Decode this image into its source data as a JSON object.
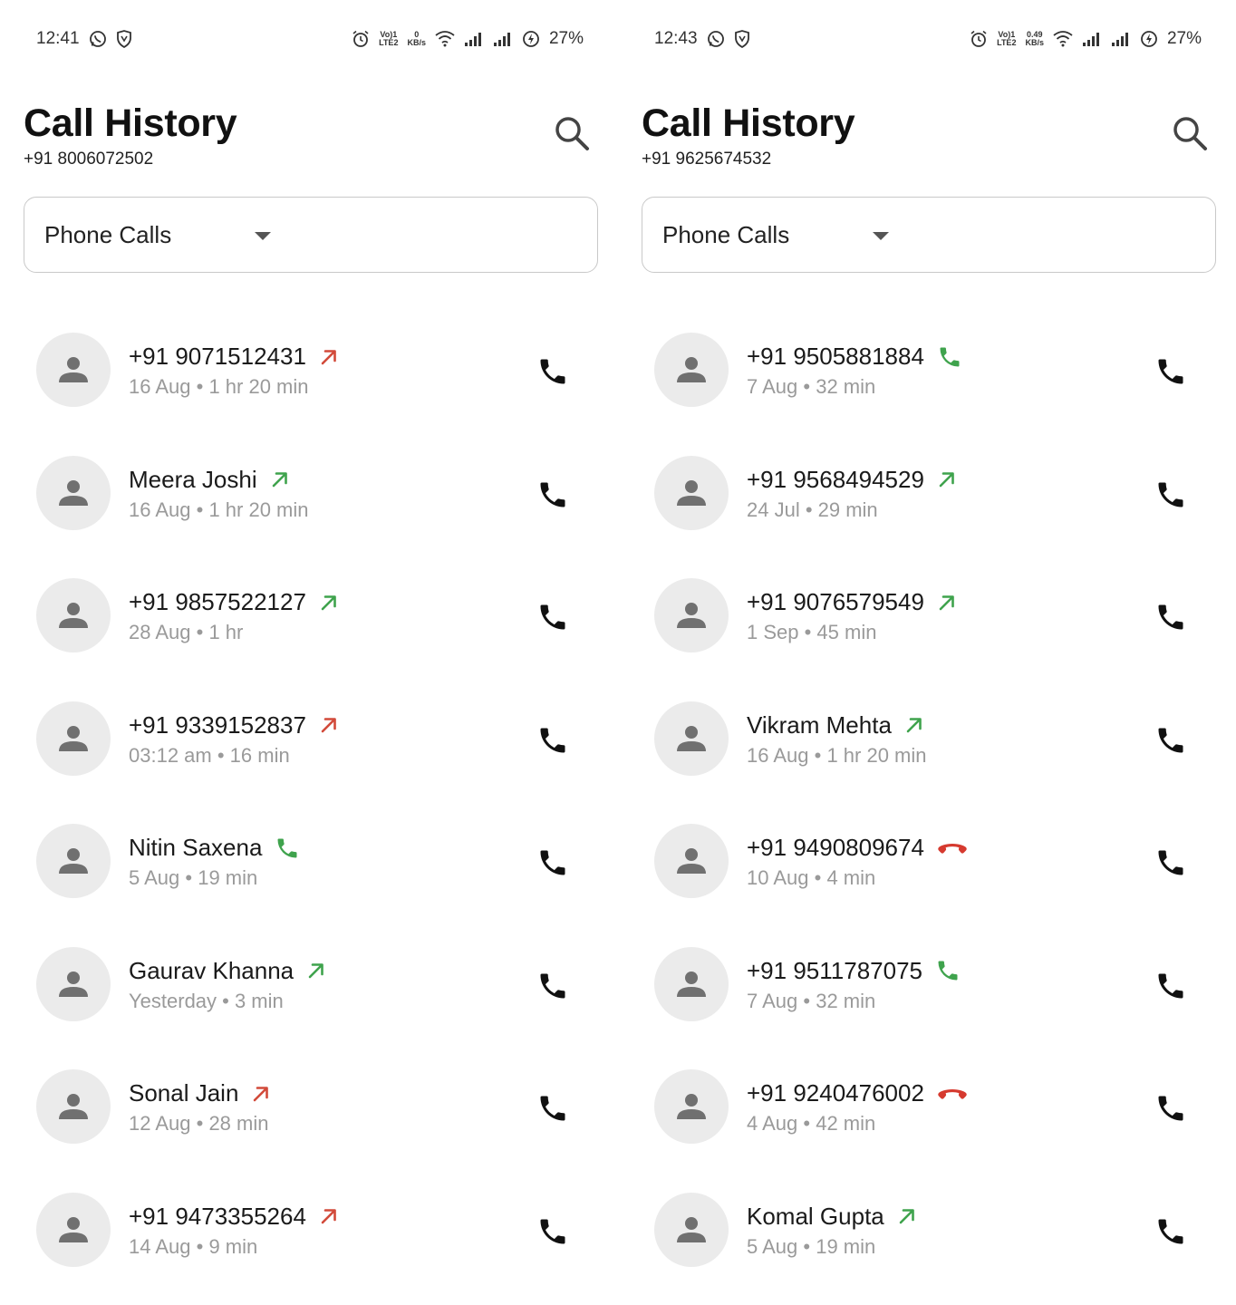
{
  "colors": {
    "outgoing": "#3fa34d",
    "outgoing_unanswered": "#d24a3a",
    "incoming": "#3fa34d",
    "missed": "#d63a2f",
    "avatar_bg": "#ebebeb",
    "meta_text": "#9a9a9a"
  },
  "screens": [
    {
      "status": {
        "time": "12:41",
        "battery": "27%",
        "net_top": "0",
        "net_bottom": "KB/s",
        "volte_top": "Vo)1",
        "volte_bottom": "LTE2"
      },
      "title": "Call History",
      "phone": "+91 8006072502",
      "filter": "Phone Calls",
      "calls": [
        {
          "name": "+91 9071512431",
          "meta": "16 Aug • 1 hr 20 min",
          "type": "outgoing_unanswered",
          "type_icon": "arrow-up-right-icon"
        },
        {
          "name": "Meera Joshi",
          "meta": "16 Aug • 1 hr 20 min",
          "type": "outgoing",
          "type_icon": "arrow-up-right-icon"
        },
        {
          "name": "+91 9857522127",
          "meta": "28 Aug • 1 hr",
          "type": "outgoing",
          "type_icon": "arrow-up-right-icon"
        },
        {
          "name": "+91 9339152837",
          "meta": "03:12 am • 16 min",
          "type": "outgoing_unanswered",
          "type_icon": "arrow-up-right-icon"
        },
        {
          "name": "Nitin Saxena",
          "meta": "5 Aug • 19 min",
          "type": "incoming",
          "type_icon": "phone-icon"
        },
        {
          "name": "Gaurav Khanna",
          "meta": "Yesterday • 3 min",
          "type": "outgoing",
          "type_icon": "arrow-up-right-icon"
        },
        {
          "name": "Sonal Jain",
          "meta": "12 Aug • 28 min",
          "type": "outgoing_unanswered",
          "type_icon": "arrow-up-right-icon"
        },
        {
          "name": "+91 9473355264",
          "meta": "14 Aug • 9 min",
          "type": "outgoing_unanswered",
          "type_icon": "arrow-up-right-icon"
        }
      ]
    },
    {
      "status": {
        "time": "12:43",
        "battery": "27%",
        "net_top": "0.49",
        "net_bottom": "KB/s",
        "volte_top": "Vo)1",
        "volte_bottom": "LTE2"
      },
      "title": "Call History",
      "phone": "+91 9625674532",
      "filter": "Phone Calls",
      "calls": [
        {
          "name": "+91 9505881884",
          "meta": "7 Aug • 32 min",
          "type": "incoming",
          "type_icon": "phone-icon"
        },
        {
          "name": "+91 9568494529",
          "meta": "24 Jul • 29 min",
          "type": "outgoing",
          "type_icon": "arrow-up-right-icon"
        },
        {
          "name": "+91 9076579549",
          "meta": "1 Sep • 45 min",
          "type": "outgoing",
          "type_icon": "arrow-up-right-icon"
        },
        {
          "name": "Vikram Mehta",
          "meta": "16 Aug • 1 hr 20 min",
          "type": "outgoing",
          "type_icon": "arrow-up-right-icon"
        },
        {
          "name": "+91 9490809674",
          "meta": "10 Aug • 4 min",
          "type": "missed",
          "type_icon": "hang-up-icon"
        },
        {
          "name": "+91 9511787075",
          "meta": "7 Aug • 32 min",
          "type": "incoming",
          "type_icon": "phone-icon"
        },
        {
          "name": "+91 9240476002",
          "meta": "4 Aug • 42 min",
          "type": "missed",
          "type_icon": "hang-up-icon"
        },
        {
          "name": "Komal Gupta",
          "meta": "5 Aug • 19 min",
          "type": "outgoing",
          "type_icon": "arrow-up-right-icon"
        }
      ]
    }
  ]
}
